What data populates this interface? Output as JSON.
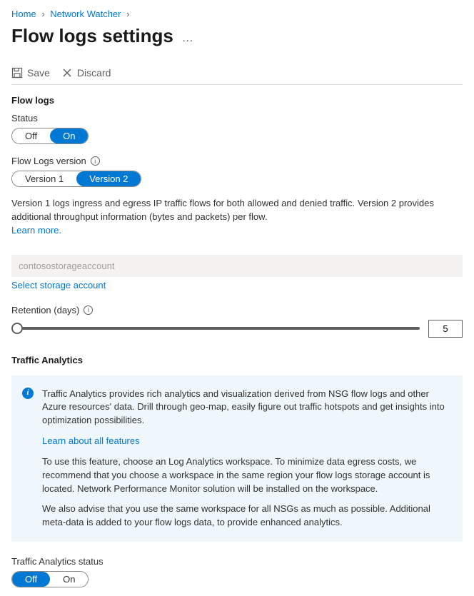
{
  "breadcrumb": {
    "home": "Home",
    "network_watcher": "Network Watcher"
  },
  "page_title": "Flow logs settings",
  "toolbar": {
    "save_label": "Save",
    "discard_label": "Discard"
  },
  "flow_logs": {
    "section_title": "Flow logs",
    "status_label": "Status",
    "status_off": "Off",
    "status_on": "On",
    "status_value": "On",
    "version_label": "Flow Logs version",
    "version_1": "Version 1",
    "version_2": "Version 2",
    "version_value": "Version 2",
    "version_desc": "Version 1 logs ingress and egress IP traffic flows for both allowed and denied traffic. Version 2 provides additional throughput information (bytes and packets) per flow.",
    "learn_more": "Learn more."
  },
  "storage": {
    "account_name": "contosostorageaccount",
    "select_link": "Select storage account"
  },
  "retention": {
    "label": "Retention (days)",
    "value": "5"
  },
  "traffic_analytics": {
    "section_title": "Traffic Analytics",
    "callout_p1": "Traffic Analytics provides rich analytics and visualization derived from NSG flow logs and other Azure resources' data. Drill through geo-map, easily figure out traffic hotspots and get insights into optimization possibilities.",
    "callout_link": "Learn about all features",
    "callout_p2": "To use this feature, choose an Log Analytics workspace. To minimize data egress costs, we recommend that you choose a workspace in the same region your flow logs storage account is located. Network Performance Monitor solution will be installed on the workspace.",
    "callout_p3": "We also advise that you use the same workspace for all NSGs as much as possible. Additional meta-data is added to your flow logs data, to provide enhanced analytics.",
    "status_label": "Traffic Analytics status",
    "status_off": "Off",
    "status_on": "On",
    "status_value": "Off"
  }
}
